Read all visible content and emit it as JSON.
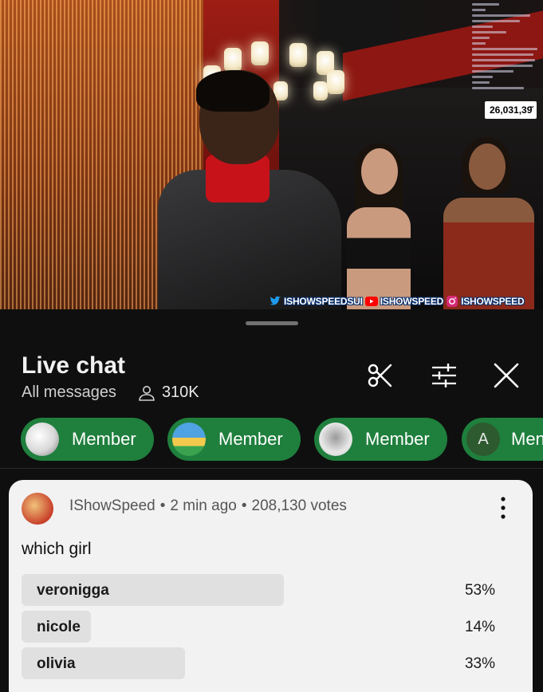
{
  "video": {
    "viewer_count": "26,031,39̆",
    "socials": [
      {
        "platform": "twitter",
        "icon": "twitter-icon",
        "handle": "ISHOWSPEEDSUI",
        "color": "#1d9bf0"
      },
      {
        "platform": "youtube",
        "icon": "youtube-icon",
        "handle": "ISHOWSPEED",
        "color": "#ff0000"
      },
      {
        "platform": "instagram",
        "icon": "instagram-icon",
        "handle": "ISHOWSPEED",
        "color": "#d62976"
      }
    ]
  },
  "chat": {
    "title": "Live chat",
    "filter": "All messages",
    "viewers": "310K",
    "header_icons": [
      "scissors-icon",
      "tune-icon",
      "close-icon"
    ],
    "chips": [
      {
        "label": "Member",
        "avatar": "member-avatar-1"
      },
      {
        "label": "Member",
        "avatar": "member-avatar-2"
      },
      {
        "label": "Member",
        "avatar": "member-avatar-3"
      },
      {
        "label": "Men",
        "letter": "A"
      }
    ],
    "accent": "#1f7f3d"
  },
  "poll": {
    "author": "IShowSpeed",
    "time": "2 min ago",
    "votes": "208,130 votes",
    "question": "which girl",
    "options": [
      {
        "label": "veronigga",
        "percent": "53%",
        "fraction": 0.53
      },
      {
        "label": "nicole",
        "percent": "14%",
        "fraction": 0.14
      },
      {
        "label": "olivia",
        "percent": "33%",
        "fraction": 0.33
      }
    ]
  }
}
